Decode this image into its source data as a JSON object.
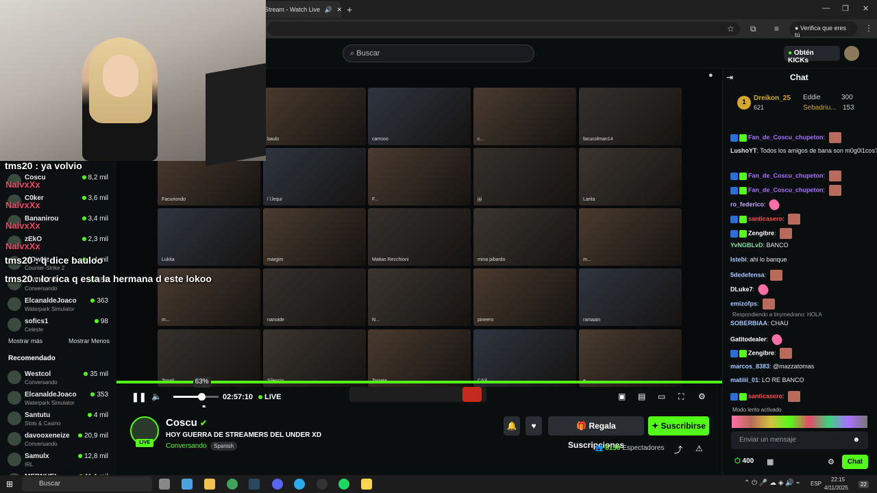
{
  "browser": {
    "tab_title": "Stream - Watch Live",
    "verify_label": "Verifica que eres tú"
  },
  "kick": {
    "search_placeholder": "Buscar",
    "kicks_button": "Obtén KICKs"
  },
  "sidebar": {
    "following": [
      {
        "name": "Coscu",
        "category": "",
        "viewers": "8,2 mil"
      },
      {
        "name": "C0ker",
        "category": "",
        "viewers": "3,6 mil"
      },
      {
        "name": "Bananirou",
        "category": "",
        "viewers": "3,4 mil"
      },
      {
        "name": "zEkO",
        "category": "",
        "viewers": "2,3 mil"
      },
      {
        "name": "elOwNz",
        "category": "Counter-Strike 2",
        "viewers": "1,4 mil"
      },
      {
        "name": "DAVICITO",
        "category": "Conversando",
        "viewers": "558"
      },
      {
        "name": "ElcanaldeJoaco",
        "category": "Waterpark Simulator",
        "viewers": "363"
      },
      {
        "name": "sofics1",
        "category": "Celeste",
        "viewers": "98"
      }
    ],
    "show_more": "Mostrar más",
    "show_less": "Mostrar Menos",
    "recommended_title": "Recomendado",
    "recommended": [
      {
        "name": "Westcol",
        "category": "Conversando",
        "viewers": "35 mil"
      },
      {
        "name": "ElcanaldeJoaco",
        "category": "Waterpark Simulator",
        "viewers": "353"
      },
      {
        "name": "Santutu",
        "category": "Slots & Casino",
        "viewers": "4 mil"
      },
      {
        "name": "davooxeneize",
        "category": "Conversando",
        "viewers": "20,9 mil"
      },
      {
        "name": "Samulx",
        "category": "IRL",
        "viewers": "12,8 mil"
      },
      {
        "name": "MERNUEL",
        "category": "",
        "viewers": "11,1 mil"
      }
    ]
  },
  "overlay_chat": [
    {
      "user": "tms20",
      "text": "ya volvio"
    },
    {
      "user": "tms20",
      "text": "q dice bauloo"
    },
    {
      "user": "tms20",
      "text": "lo rica q esta la hermana d este lokoo"
    }
  ],
  "overlay_names": [
    "NalvxXx",
    "NalvxXx",
    "NalvxXx",
    "NalvxXx"
  ],
  "video_tiles": [
    "bananirou",
    "baulo",
    "carrooo",
    "c...",
    "facucolman14",
    "Facuriondo",
    "l l.lequi",
    "F...",
    "jiji",
    "Larita",
    "Lukita",
    "margim",
    "Matias Recchioni",
    "mina pibardo",
    "m...",
    "m...",
    "nanoide",
    "N...",
    "pineero",
    "ramaain",
    "Tonali",
    "Silencio",
    "Torreta",
    "CAS",
    "e..."
  ],
  "player": {
    "volume_percent": 63,
    "time": "02:57:10",
    "live_label": "LIVE"
  },
  "stream": {
    "channel": "Coscu",
    "title": "HOY GUERRA DE STREAMERS DEL UNDER XD",
    "category": "Conversando",
    "language": "Spanish",
    "live_badge": "LIVE",
    "gift_button": "Regala Suscripciones",
    "subscribe_button": "Suscribirse",
    "viewers": "8150",
    "viewers_label": "Espectadores"
  },
  "chat": {
    "title": "Chat",
    "leaderboard": [
      {
        "rank": "1",
        "name": "Dreikon_25",
        "value": "621"
      },
      {
        "name": "Eddie",
        "value": "300"
      },
      {
        "name": "Sebadriu...",
        "value": "153"
      }
    ],
    "messages": [
      {
        "user": "Fan_de_Coscu_chupeton",
        "color": "#a970ff",
        "text": ""
      },
      {
        "user": "LushoYT",
        "color": "#e8e8e8",
        "text": "Todos los amigos de bana son m0g0l1cos?"
      },
      {
        "user": "Fan_de_Coscu_chupeton",
        "color": "#a970ff",
        "text": ""
      },
      {
        "user": "Fan_de_Coscu_chupeton",
        "color": "#a970ff",
        "text": ""
      },
      {
        "user": "ro_federico",
        "color": "#c7a4ff",
        "text": ""
      },
      {
        "user": "santicasero",
        "color": "#ff4d4d",
        "text": ""
      },
      {
        "user": "Zengibre",
        "color": "#ffffff",
        "text": ""
      },
      {
        "user": "YvNGBLvD",
        "color": "#7ce0a8",
        "text": "BANCO"
      },
      {
        "user": "Istebi",
        "color": "#a4c8ff",
        "text": "ahi lo banque"
      },
      {
        "user": "5dedefensa",
        "color": "#a4c8ff",
        "text": ""
      },
      {
        "user": "DLuke7",
        "color": "#ffffff",
        "text": ""
      },
      {
        "user": "emizofps",
        "color": "#a4c8ff",
        "text": ""
      },
      {
        "user": "SOBERBIAA",
        "color": "#a4c8ff",
        "text": "CHAU"
      },
      {
        "user": "Gatitodealer",
        "color": "#ffffff",
        "text": ""
      },
      {
        "user": "Zengibre",
        "color": "#ffffff",
        "text": ""
      },
      {
        "user": "marcos_8383",
        "color": "#a4c8ff",
        "text": "@mazzatomas"
      },
      {
        "user": "matiiii_01",
        "color": "#a4c8ff",
        "text": "LO RE BANCO"
      },
      {
        "user": "santicasero",
        "color": "#ff4d4d",
        "text": ""
      }
    ],
    "reply_note": "Respondiendo a tinymedrano: HOLA",
    "slow_mode": "Modo lento activado",
    "input_placeholder": "Enviar un mensaje",
    "points": "400",
    "send_button": "Chat"
  },
  "taskbar": {
    "search_label": "Buscar",
    "lang": "ESP",
    "time": "22:15",
    "date": "4/11/2025",
    "notif_count": "22"
  }
}
